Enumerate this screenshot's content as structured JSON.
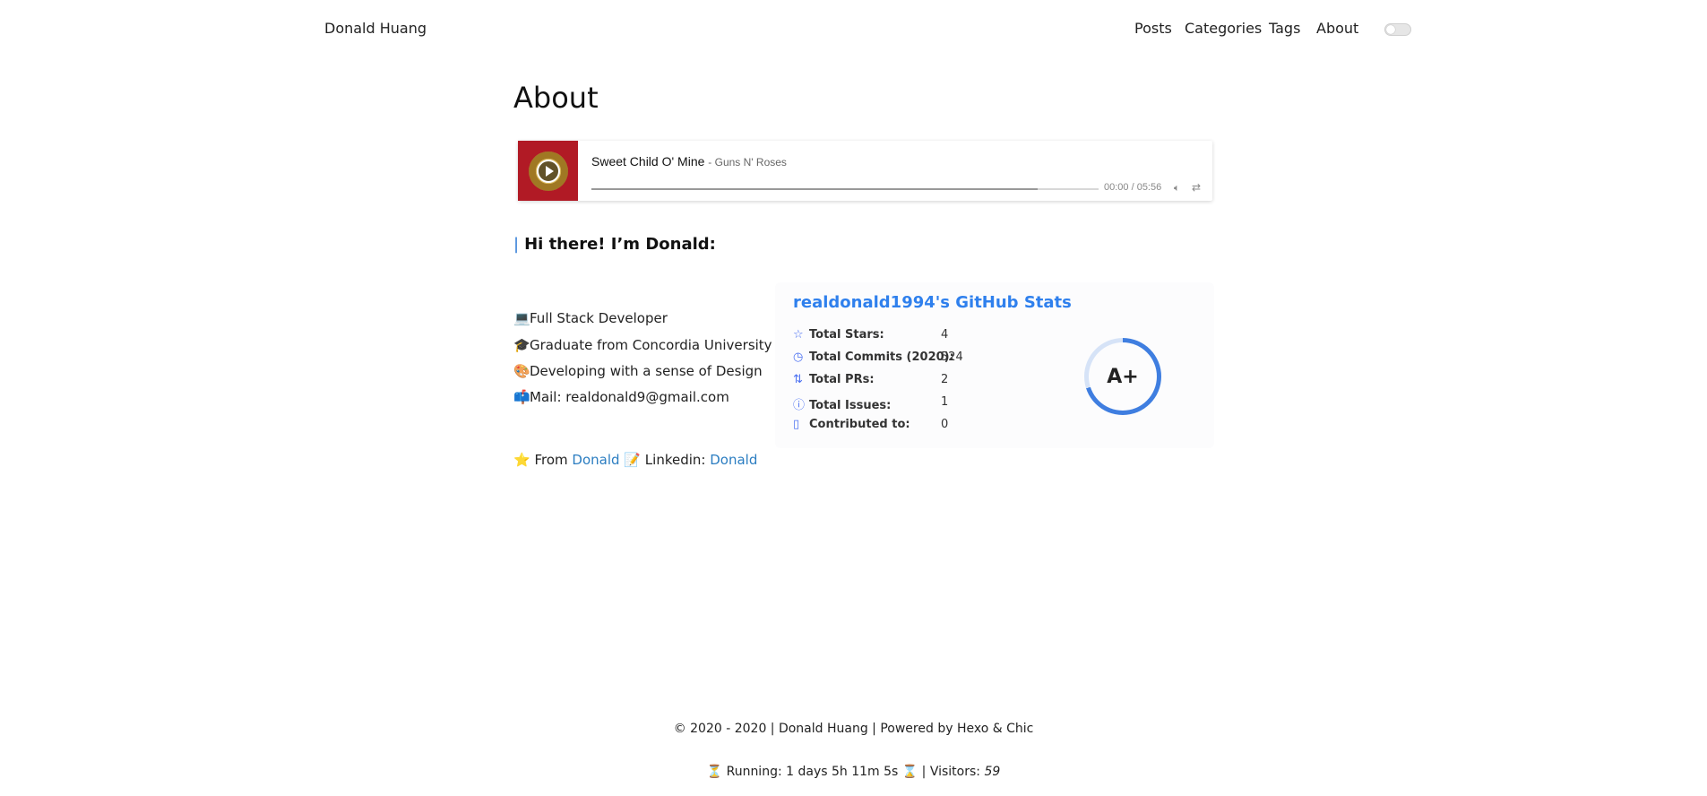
{
  "header": {
    "brand": "Donald Huang",
    "nav": [
      "Posts",
      "Categories",
      "Tags",
      "About"
    ]
  },
  "page_title": "About",
  "player": {
    "title": "Sweet Child O' Mine",
    "artist": "- Guns N' Roses",
    "time": "00:00 / 05:56",
    "progress": 0.88
  },
  "greeting": "Hi there! I’m Donald:",
  "bio": [
    {
      "icon": "💻",
      "text": "Full Stack Developer"
    },
    {
      "icon": "🎓",
      "text": "Graduate from Concordia University"
    },
    {
      "icon": "🎨",
      "text": "Developing with a sense of Design"
    },
    {
      "icon": "📫",
      "text": "Mail: realdonald9@gmail.com"
    }
  ],
  "stats": {
    "title": "realdonald1994's GitHub Stats",
    "rows": [
      {
        "label": "Total Stars:",
        "value": "4"
      },
      {
        "label": "Total Commits (2020):",
        "value": "524"
      },
      {
        "label": "Total PRs:",
        "value": "2"
      },
      {
        "label": "Total Issues:",
        "value": "1"
      },
      {
        "label": "Contributed to:",
        "value": "0"
      }
    ],
    "grade": "A+"
  },
  "from": {
    "prefix": "From",
    "from_link": "Donald",
    "linkedin_label": "Linkedin:",
    "linkedin_link": "Donald"
  },
  "footer": {
    "copyright": "© 2020 - 2020 | Donald Huang | Powered by Hexo & Chic",
    "running": "Running: 1 days 5h 11m 5s",
    "visitors_label": "| Visitors:",
    "visitors": "59"
  },
  "colors": {
    "accent": "#2f80ed",
    "link": "#2b7dc1",
    "player_cover": "#b11a25"
  }
}
